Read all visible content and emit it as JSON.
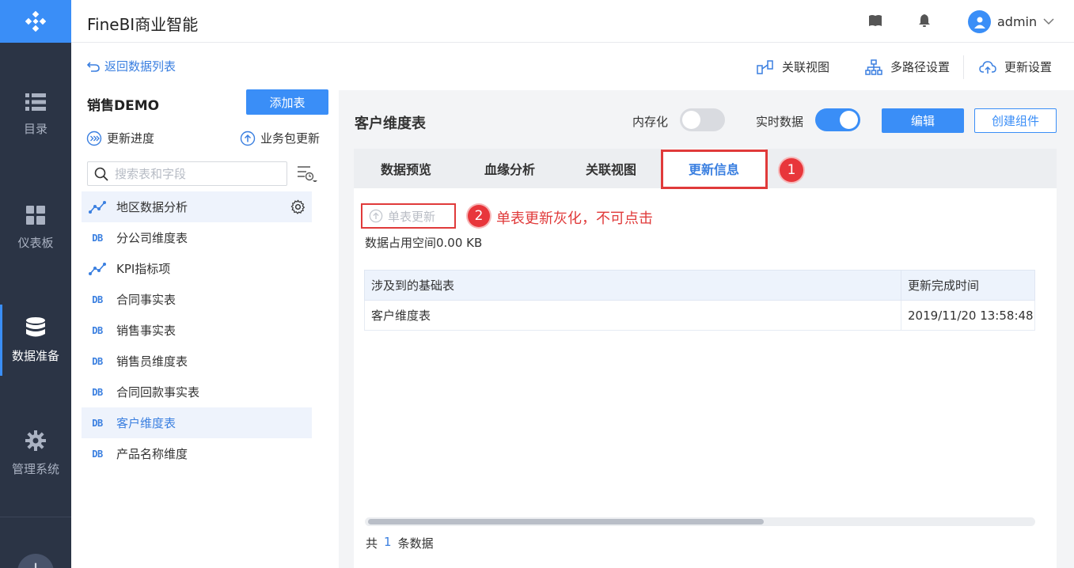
{
  "app": {
    "title": "FineBI商业智能",
    "user": "admin"
  },
  "rail": {
    "items": [
      {
        "label": "目录",
        "icon": "list-icon"
      },
      {
        "label": "仪表板",
        "icon": "dashboard-icon"
      },
      {
        "label": "数据准备",
        "icon": "database-icon",
        "active": true
      },
      {
        "label": "管理系统",
        "icon": "gear-icon"
      }
    ],
    "plus": "+"
  },
  "toolbar": {
    "back": "返回数据列表",
    "relation_view": "关联视图",
    "multipath": "多路径设置",
    "update_settings": "更新设置"
  },
  "package": {
    "name": "销售DEMO",
    "add_table": "添加表",
    "update_progress": "更新进度",
    "package_update": "业务包更新",
    "search_placeholder": "搜索表和字段",
    "tables": [
      {
        "label": "地区数据分析",
        "type": "analysis"
      },
      {
        "label": "分公司维度表",
        "type": "DB"
      },
      {
        "label": "KPI指标项",
        "type": "analysis"
      },
      {
        "label": "合同事实表",
        "type": "DB"
      },
      {
        "label": "销售事实表",
        "type": "DB"
      },
      {
        "label": "销售员维度表",
        "type": "DB"
      },
      {
        "label": "合同回款事实表",
        "type": "DB"
      },
      {
        "label": "客户维度表",
        "type": "DB",
        "selected": true
      },
      {
        "label": "产品名称维度",
        "type": "DB"
      }
    ],
    "db_tag": "DB"
  },
  "detail": {
    "title": "客户维度表",
    "in_memory_label": "内存化",
    "in_memory": false,
    "realtime_label": "实时数据",
    "realtime": true,
    "edit": "编辑",
    "create_component": "创建组件",
    "tabs": [
      "数据预览",
      "血缘分析",
      "关联视图",
      "更新信息"
    ],
    "active_tab": "更新信息",
    "single_update": "单表更新",
    "storage": "数据占用空间0.00 KB",
    "table": {
      "headers": [
        "涉及到的基础表",
        "更新完成时间"
      ],
      "rows": [
        [
          "客户维度表",
          "2019/11/20 13:58:48"
        ]
      ]
    },
    "total_prefix": "共",
    "total_count": "1",
    "total_suffix": "条数据"
  },
  "annotations": {
    "badge1": "1",
    "badge2": "2",
    "note2": "单表更新灰化，不可点击",
    "color": "#e03a3a"
  },
  "colors": {
    "accent": "#3a8ef7",
    "rail_bg": "#2b3445"
  }
}
